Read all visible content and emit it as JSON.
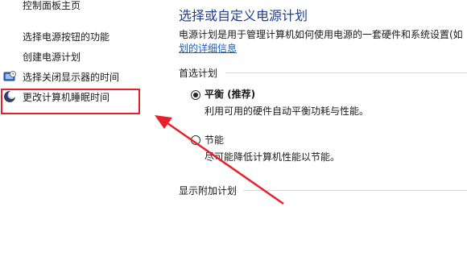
{
  "sidebar": {
    "home": "控制面板主页",
    "items": [
      {
        "label": "选择电源按钮的功能",
        "icon": ""
      },
      {
        "label": "创建电源计划",
        "icon": ""
      },
      {
        "label": "选择关闭显示器的时间",
        "icon": "display-clock-icon"
      },
      {
        "label": "更改计算机睡眠时间",
        "icon": "moon-icon"
      }
    ]
  },
  "main": {
    "title": "选择或自定义电源计划",
    "description": "电源计划是用于管理计算机如何使用电源的一套硬件和系统设置(如",
    "description_link": "划的详细信息",
    "preferred_section": "首选计划",
    "plans": [
      {
        "name": "平衡 (推荐)",
        "desc": "利用可用的硬件自动平衡功耗与性能。",
        "selected": true
      },
      {
        "name": "节能",
        "desc": "尽可能降低计算机性能以节能。",
        "selected": false
      }
    ],
    "additional_section": "显示附加计划"
  },
  "annotation": {
    "color": "#e8202a"
  }
}
